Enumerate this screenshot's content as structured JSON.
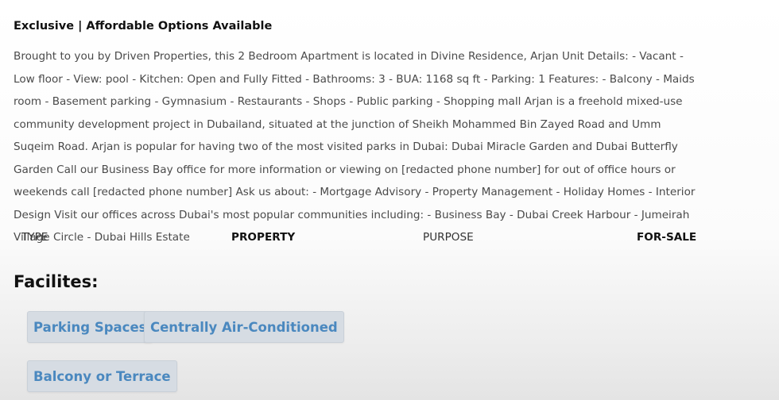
{
  "listing": {
    "headline": "Exclusive | Affordable Options Available",
    "description": "Brought to you by Driven Properties, this 2 Bedroom Apartment is located in Divine Residence, Arjan Unit Details: - Vacant - Low floor - View: pool - Kitchen: Open and Fully Fitted - Bathrooms: 3 - BUA: 1168 sq ft - Parking: 1 Features: - Balcony - Maids room - Basement parking - Gymnasium - Restaurants - Shops - Public parking - Shopping mall Arjan is a freehold mixed-use community development project in Dubailand, situated at the junction of Sheikh Mohammed Bin Zayed Road and Umm Suqeim Road. Arjan is popular for having two of the most visited parks in Dubai: Dubai Miracle Garden and Dubai Butterfly Garden Call our Business Bay office for more information or viewing on [redacted phone number] for out of office hours or weekends call [redacted phone number] Ask us about: - Mortgage Advisory - Property Management - Holiday Homes - Interior Design Visit our offices across Dubai's most popular communities including: - Business Bay - Dubai Creek Harbour - Jumeirah Village Circle - Dubai Hills Estate"
  },
  "meta": {
    "type_label": "TYPE",
    "type_value": "PROPERTY",
    "purpose_label": "PURPOSE",
    "purpose_value": "FOR-SALE"
  },
  "facilities": {
    "title": "Facilites:",
    "items": [
      "Parking Spaces",
      "Centrally Air-Conditioned",
      "Balcony or Terrace"
    ]
  },
  "colors": {
    "chip_background": "#d6dce3",
    "chip_text": "#4a88bf"
  }
}
